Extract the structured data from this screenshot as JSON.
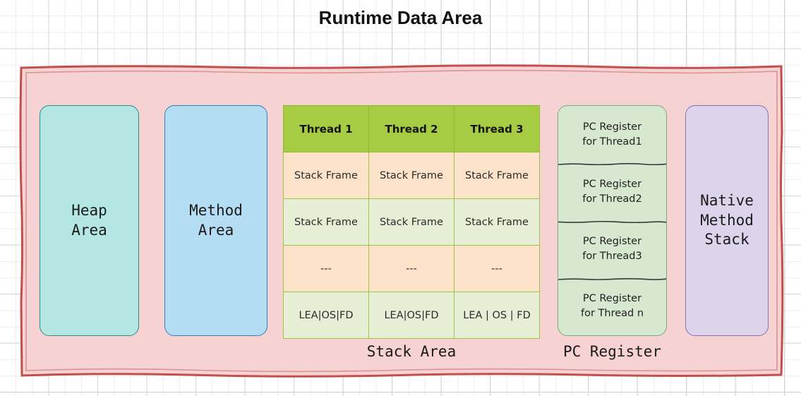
{
  "title": "Runtime Data Area",
  "colors": {
    "container_fill": "#f7d2d2",
    "container_border": "#c0504d",
    "heap_fill": "#b4e7e3",
    "method_fill": "#b4dcf2",
    "native_fill": "#ddd4ec",
    "table_header_fill": "#a5cc42",
    "row_peach": "#fce2c9",
    "row_green": "#e6eed5",
    "pc_fill": "#d7e8d0"
  },
  "heap_area": {
    "label": "Heap\nArea"
  },
  "method_area": {
    "label": "Method\nArea"
  },
  "native_method_stack": {
    "label": "Native\nMethod\nStack"
  },
  "stack_area": {
    "caption": "Stack Area",
    "headers": [
      "Thread 1",
      "Thread 2",
      "Thread 3"
    ],
    "rows": [
      {
        "style": "peach",
        "cells": [
          "Stack Frame",
          "Stack Frame",
          "Stack Frame"
        ]
      },
      {
        "style": "green",
        "cells": [
          "Stack Frame",
          "Stack Frame",
          "Stack Frame"
        ]
      },
      {
        "style": "peach",
        "cells": [
          "---",
          "---",
          "---"
        ]
      },
      {
        "style": "green",
        "cells": [
          "LEA|OS|FD",
          "LEA|OS|FD",
          "LEA | OS | FD"
        ]
      }
    ]
  },
  "pc_register": {
    "caption": "PC Register",
    "cells": [
      "PC Register\nfor  Thread1",
      "PC Register\nfor  Thread2",
      "PC Register\nfor  Thread3",
      "PC Register\nfor  Thread n"
    ]
  }
}
